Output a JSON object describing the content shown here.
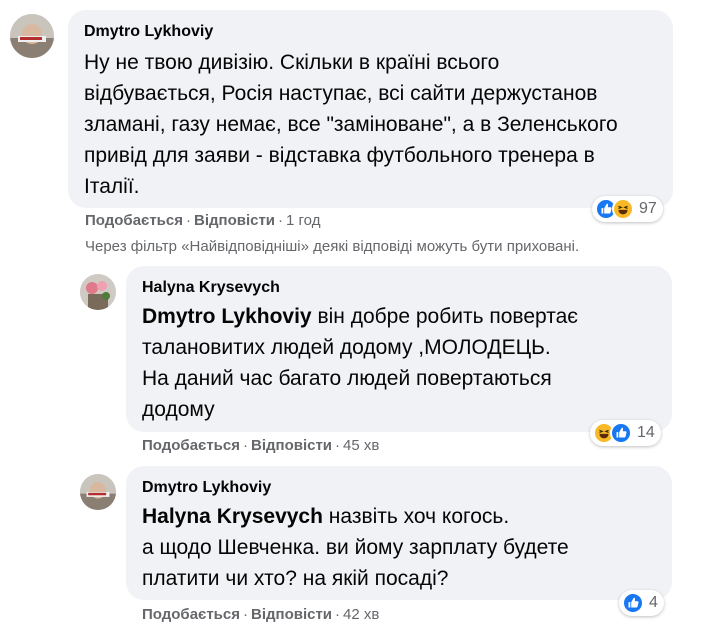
{
  "comments": [
    {
      "author": "Dmytro Lykhoviy",
      "lines": [
        "Ну не твою дивізію. Скільки в країні всього",
        "відбувається, Росія наступає, всі сайти держустанов",
        "зламані, газу немає, все \"заміноване\", а в Зеленського",
        "привід для заяви - відставка футбольного тренера в",
        "Італії."
      ],
      "like_label": "Подобається",
      "reply_label": "Відповісти",
      "time": "1 год",
      "reactions": [
        "like-icon",
        "haha-icon"
      ],
      "reaction_count": "97"
    },
    {
      "author": "Halyna Krysevych",
      "mention": "Dmytro Lykhoviy",
      "lines": [
        " він добре робить повертає",
        "талановитих людей додому ,МОЛОДЕЦЬ.",
        "На даний час багато людей повертаються",
        "додому"
      ],
      "like_label": "Подобається",
      "reply_label": "Відповісти",
      "time": "45 хв",
      "reactions": [
        "haha-icon",
        "like-icon"
      ],
      "reaction_count": "14"
    },
    {
      "author": "Dmytro Lykhoviy",
      "mention": "Halyna Krysevych",
      "lines": [
        " назвіть хоч когось.",
        "а щодо Шевченка. ви йому зарплату будете",
        "платити чи хто? на якій посаді?"
      ],
      "like_label": "Подобається",
      "reply_label": "Відповісти",
      "time": "42 хв",
      "reactions": [
        "like-icon"
      ],
      "reaction_count": "4"
    }
  ],
  "filter_notice": "Через фільтр «Найвідповідніші» деякі відповіді можуть бути приховані.",
  "colors": {
    "bubble": "#f0f2f5",
    "secondary_text": "#65676b",
    "like_blue": "#1877f2",
    "haha_yellow": "#f7b928"
  }
}
